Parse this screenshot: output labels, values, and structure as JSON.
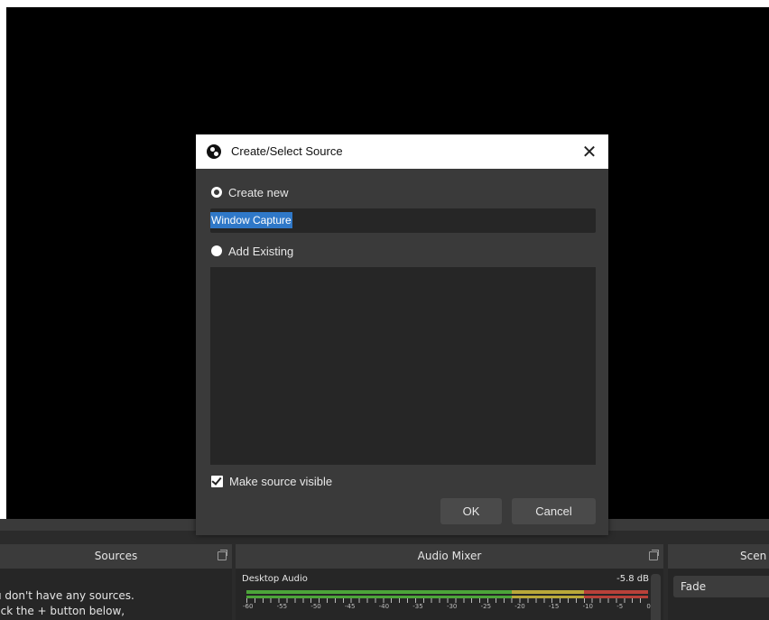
{
  "preview": {},
  "docks": {
    "sources": {
      "title": "Sources",
      "empty_line1": "u don't have any sources.",
      "empty_line2": "lick the + button below,"
    },
    "audio_mixer": {
      "title": "Audio Mixer",
      "channel": {
        "name": "Desktop Audio",
        "level": "-5.8 dB",
        "scale": [
          "-60",
          "-55",
          "-50",
          "-45",
          "-40",
          "-35",
          "-30",
          "-25",
          "-20",
          "-15",
          "-10",
          "-5",
          "0"
        ]
      }
    },
    "scene_transitions": {
      "title": "Scen",
      "transition_value": "Fade"
    }
  },
  "dialog": {
    "title": "Create/Select Source",
    "create_new_label": "Create new",
    "name_value": "Window Capture",
    "add_existing_label": "Add Existing",
    "make_visible_label": "Make source visible",
    "ok_label": "OK",
    "cancel_label": "Cancel",
    "close_glyph": "✕"
  }
}
